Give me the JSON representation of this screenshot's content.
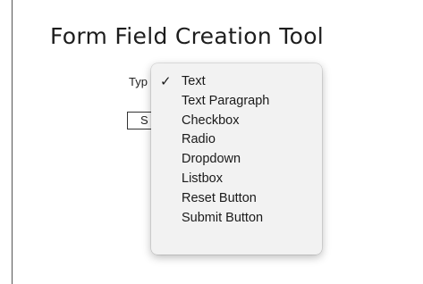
{
  "page": {
    "title": "Form Field Creation Tool",
    "type_label": "Typ",
    "save_button_label": "S"
  },
  "dropdown": {
    "selected": "Text",
    "check_glyph": "✓",
    "options": [
      "Text",
      "Text Paragraph",
      "Checkbox",
      "Radio",
      "Dropdown",
      "Listbox",
      "Reset Button",
      "Submit Button"
    ]
  },
  "colors": {
    "menu_background": "#f2f2f2",
    "text": "#1a1a1a"
  }
}
